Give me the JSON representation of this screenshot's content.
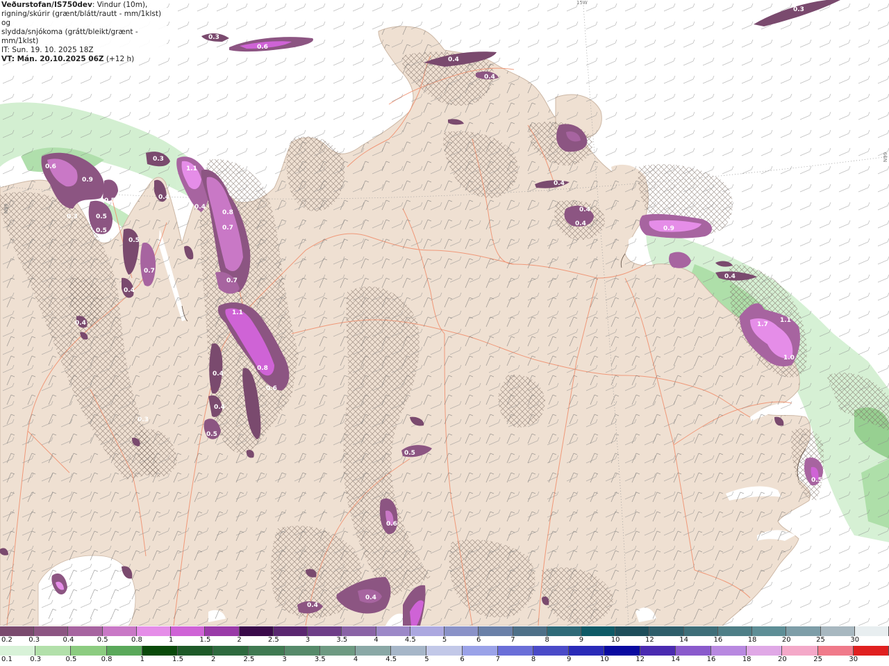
{
  "header": {
    "title": "Veðurstofan/IS750dev",
    "desc_line1": ": Vindur (10m),",
    "desc_line2": "rigning/skúrir (grænt/blátt/rautt - mm/1klst) og",
    "desc_line3": "slydda/snjókoma (grátt/bleikt/grænt - mm/1klst)",
    "it": "IT: Sun. 19. 10. 2025 18Z",
    "vt": "VT: Mán. 20.10.2025 06Z",
    "vt_offset": "(+12 h)"
  },
  "grid_labels": {
    "lon_top": "15W",
    "lat_left": "N99",
    "lat_right": "N99"
  },
  "precip_values": [
    "0.3",
    "0.6",
    "0.3",
    "0.4",
    "0.4",
    "0.3",
    "0.9",
    "0.5",
    "0.5",
    "0.5",
    "0.3",
    "1.1",
    "0.6",
    "0.4",
    "0.8",
    "0.7",
    "0.5",
    "0.7",
    "0.4",
    "0.7",
    "0.4",
    "1.1",
    "0.8",
    "0.6",
    "0.4",
    "0.4",
    "0.3",
    "0.5",
    "0.5",
    "0.6",
    "0.4",
    "0.4",
    "0.4",
    "0.4",
    "0.9",
    "0.4",
    "1.7",
    "1.1",
    "1.0",
    "0.5",
    "0.4",
    "0.4"
  ],
  "legend_snow": {
    "labels": [
      "0.2",
      "0.3",
      "0.4",
      "0.5",
      "0.8",
      "1",
      "1.5",
      "2",
      "2.5",
      "3",
      "3.5",
      "4",
      "4.5",
      "5",
      "6",
      "7",
      "8",
      "9",
      "10",
      "12",
      "14",
      "16",
      "18",
      "20",
      "25",
      "30"
    ],
    "colors": [
      "#7a4a6e",
      "#8c5582",
      "#a764a0",
      "#c978c6",
      "#e58de8",
      "#cf63d6",
      "#9a3aa8",
      "#3a0a4a",
      "#5a2670",
      "#6e3e88",
      "#8a63a6",
      "#9c88c8",
      "#aca8e0",
      "#8a92c8",
      "#6a80a8",
      "#4e7088",
      "#2e6a78",
      "#0e5a66",
      "#1e4e5a",
      "#2e5e6a",
      "#3e6e78",
      "#4e7e86",
      "#5e8e96",
      "#7e9ea8",
      "#a8b8c0",
      "#e8eef0"
    ]
  },
  "legend_rain": {
    "labels": [
      "0.1",
      "0.3",
      "0.5",
      "0.8",
      "1",
      "1.5",
      "2",
      "2.5",
      "3",
      "3.5",
      "4",
      "4.5",
      "5",
      "6",
      "7",
      "8",
      "9",
      "10",
      "12",
      "14",
      "16",
      "18",
      "20",
      "25",
      "30"
    ],
    "colors": [
      "#d8f2d8",
      "#b2e0aa",
      "#8ccc80",
      "#5aa85a",
      "#0a4a0a",
      "#1e5a28",
      "#2e6a3e",
      "#407a52",
      "#568a6a",
      "#6e9a82",
      "#8aa8a6",
      "#a6b6c8",
      "#c2c8e8",
      "#9aa2e8",
      "#6a6ed8",
      "#4a4ac8",
      "#2a2ab8",
      "#0a0aa0",
      "#4a2ab0",
      "#8a5acc",
      "#b888e0",
      "#e0a8e6",
      "#f4a8c8",
      "#f07a8a",
      "#e02020"
    ]
  },
  "colors": {
    "land": "#efe0d2",
    "land_edge": "#cdb8a6",
    "road": "#f08c6a",
    "snow_light": "#7a4a6e",
    "snow_mid": "#a764a0",
    "snow_heavy": "#e88ae9",
    "rain_light": "#c8ecc8",
    "rain_mid": "#9ad59a",
    "hatch": "#7a6a60"
  }
}
